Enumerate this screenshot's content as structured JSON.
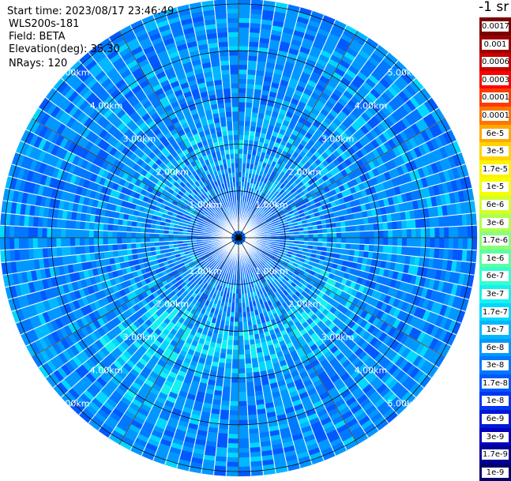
{
  "info": {
    "start_time": "Start time: 2023/08/17 23:46:49",
    "device": "WLS200s-181",
    "field": "Field: BETA",
    "elevation": "Elevation(deg): 35.30",
    "nrays": "NRays: 120"
  },
  "colors": {
    "background_fill": "#2a6fe8",
    "grid_line": "#000000",
    "ray_line": "#ffffff",
    "tick_label": "#ffffff"
  },
  "chart_data": {
    "type": "heatmap",
    "projection": "polar (PPI)",
    "range_unit": "km",
    "range_rings_km": [
      1,
      2,
      3,
      4,
      5
    ],
    "ring_labels": [
      "1.00km",
      "2.00km",
      "3.00km",
      "4.00km",
      "5.00km"
    ],
    "r_max_km": 5.1,
    "radial_gridlines_deg": [
      0,
      30,
      60,
      90,
      120,
      150,
      180,
      210,
      240,
      270,
      300,
      330
    ],
    "label_azimuths_deg": [
      45,
      135,
      225,
      315
    ],
    "nrays": 120,
    "colorbar": {
      "units": "-1 sr",
      "labels": [
        "0.0017",
        "0.001",
        "0.0006",
        "0.0003",
        "0.00017",
        "0.0001",
        "6e-5",
        "3e-5",
        "1.7e-5",
        "1e-5",
        "6e-6",
        "3e-6",
        "1.7e-6",
        "1e-6",
        "6e-7",
        "3e-7",
        "1.7e-7",
        "1e-7",
        "6e-8",
        "3e-8",
        "1.7e-8",
        "1e-8",
        "6e-9",
        "3e-9",
        "1.7e-9",
        "1e-9"
      ],
      "colors": [
        "#7a0000",
        "#9a0000",
        "#c80000",
        "#ff0000",
        "#ff3a00",
        "#ff7400",
        "#ffa800",
        "#ffd400",
        "#fff200",
        "#f4ff00",
        "#d2ff28",
        "#b0ff4e",
        "#88ff78",
        "#5dffa0",
        "#35ffcc",
        "#14f2f0",
        "#00d8ff",
        "#00b8ff",
        "#0098ff",
        "#0078ff",
        "#0058ff",
        "#0036f0",
        "#0018d8",
        "#0000bc",
        "#000096",
        "#00006e"
      ]
    },
    "dominant_value_range": [
      "6e-8",
      "1.7e-8"
    ]
  }
}
